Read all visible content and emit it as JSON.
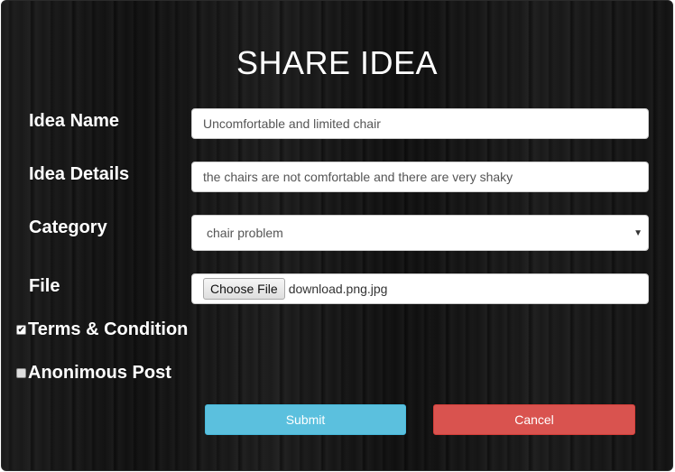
{
  "form": {
    "title": "SHARE IDEA",
    "idea_name": {
      "label": "Idea Name",
      "value": "Uncomfortable and limited chair"
    },
    "idea_details": {
      "label": "Idea Details",
      "value": "the chairs are not comfortable and there are very shaky"
    },
    "category": {
      "label": "Category",
      "selected": "chair problem",
      "caret_glyph": "▼"
    },
    "file": {
      "label": "File",
      "button_label": "Choose File",
      "file_name": "download.png.jpg"
    },
    "terms": {
      "label": "Terms & Condition",
      "checked": true,
      "check_glyph": "✔"
    },
    "anonymous": {
      "label": "Anonimous Post",
      "checked": false
    },
    "buttons": {
      "submit_label": "Submit",
      "cancel_label": "Cancel"
    }
  },
  "colors": {
    "submit": "#5bc0de",
    "cancel": "#d9534f",
    "panel_background": "#141414",
    "text": "#ffffff"
  }
}
